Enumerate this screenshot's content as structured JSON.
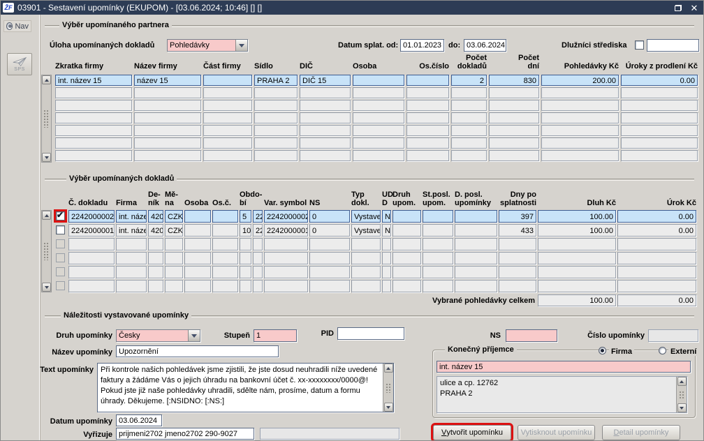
{
  "titlebar": {
    "icon_text": "ŽF",
    "title": "03901 - Sestavení upomínky (EKUPOM) - [03.06.2024; 10:46]  []  []"
  },
  "icons": {
    "check_glyph": "✔",
    "close_glyph": "✕"
  },
  "sidebar": {
    "nav_label": "Nav",
    "sps_label": "SPS"
  },
  "partner_section": {
    "title": "Výběr upomínaného partnera",
    "uloha_label": "Úloha upomínaných dokladů",
    "uloha_value": "Pohledávky",
    "datum_od_label": "Datum splat. od:",
    "datum_od_value": "01.01.2023",
    "datum_do_label": "do:",
    "datum_do_value": "03.06.2024",
    "dluznici_label": "Dlužníci střediska",
    "columns": [
      "Zkratka firmy",
      "Název firmy",
      "Část firmy",
      "Sídlo",
      "DIČ",
      "Osoba",
      "Os.číslo",
      "Počet\ndokladů",
      "Počet\ndní",
      "Pohledávky Kč",
      "Úroky z prodlení Kč"
    ],
    "row": {
      "cells": [
        "int. název 15",
        "název 15",
        "",
        "PRAHA 2",
        "DIČ 15",
        "",
        "",
        "2",
        "830",
        "200.00",
        "0.00"
      ]
    }
  },
  "documents_section": {
    "title": "Výběr upomínaných dokladů",
    "columns": [
      "Č. dokladu",
      "Firma",
      "De-\nník",
      "Mě-\nna",
      "Osoba",
      "Os.č.",
      "Obdo-\nbí",
      "",
      "Var. symbol",
      "NS",
      "Typ\ndokl.",
      "UD\nD",
      "Druh\nupom.",
      "St.posl.\nupom.",
      "D. posl.\nupomínky",
      "Dny po\nsplatnosti",
      "Dluh Kč",
      "Úrok Kč"
    ],
    "rows": [
      {
        "cells": [
          "2242000002",
          "int. náze",
          "420",
          "CZK",
          "",
          "",
          "5",
          "22",
          "2242000002",
          "0",
          "Vystave",
          "N",
          "",
          "",
          "",
          "397",
          "100.00",
          "0.00"
        ]
      },
      {
        "cells": [
          "2242000001",
          "int. náze",
          "420",
          "CZK",
          "",
          "",
          "10",
          "22",
          "2242000001",
          "0",
          "Vystave",
          "N",
          "",
          "",
          "",
          "433",
          "100.00",
          "0.00"
        ]
      }
    ],
    "total_label": "Vybrané pohledávky celkem",
    "total_dluh": "100.00",
    "total_urok": "0.00"
  },
  "reminder_section": {
    "title": "Náležitosti vystavované upomínky",
    "druh_label": "Druh upomínky",
    "druh_value": "Česky",
    "stupen_label": "Stupeň",
    "stupen_value": "1",
    "pid_label": "PID",
    "ns_label": "NS",
    "cislo_label": "Číslo upomínky",
    "nazev_label": "Název upomínky",
    "nazev_value": "Upozornění",
    "text_label": "Text upomínky",
    "text_value": "Při kontrole našich pohledávek jsme zjistili, že jste dosud neuhradili níže uvedené faktury a žádáme Vás o jejich úhradu na bankovní účet č. xx-xxxxxxxx/0000@! Pokud jste již naše pohledávky uhradili, sdělte nám, prosíme, datum a formu úhrady. Děkujeme. [:NSIDNO: [:NS:]",
    "datum_label": "Datum upomínky",
    "datum_value": "03.06.2024",
    "vyrizuje_label": "Vyřizuje",
    "vyrizuje_value": "prijmeni2702 jmeno2702 290-9027",
    "prijemce": {
      "title": "Konečný příjemce",
      "radio_firma": "Firma",
      "radio_externi": "Externí",
      "name_value": "int. název 15",
      "address_value": "ulice a cp. 12762\nPRAHA 2"
    },
    "buttons": {
      "create_accel": "V",
      "create_rest": "ytvořit upomínku",
      "print": "Vytisknout upomínku",
      "detail_accel": "D",
      "detail_rest": "etail upomínky"
    }
  },
  "colors": {
    "titlebar": "#2d3c55",
    "selected_row": "#c8e3f8",
    "required_pink": "#f8caca",
    "highlight_red": "#dd1111"
  }
}
